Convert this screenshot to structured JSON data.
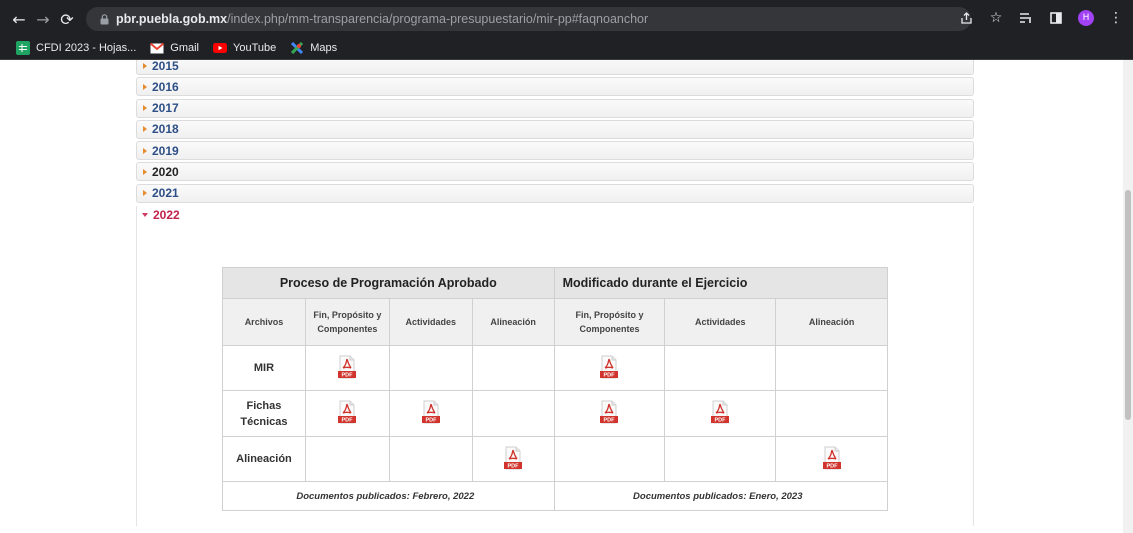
{
  "browser": {
    "url_host": "pbr.puebla.gob.mx",
    "url_path": "/index.php/mm-transparencia/programa-presupuestario/mir-pp#faqnoanchor",
    "avatar_letter": "H"
  },
  "bookmarks": [
    {
      "label": "CFDI 2023 - Hojas...",
      "icon": "sheets-icon",
      "color": "#1fa463"
    },
    {
      "label": "Gmail",
      "icon": "gmail-icon",
      "color": "#ea4335"
    },
    {
      "label": "YouTube",
      "icon": "youtube-icon",
      "color": "#ff0000"
    },
    {
      "label": "Maps",
      "icon": "maps-icon",
      "color": "#34a853"
    }
  ],
  "years": [
    "2015",
    "2016",
    "2017",
    "2018",
    "2019",
    "2020",
    "2021"
  ],
  "open_year": "2022",
  "table": {
    "group_left": "Proceso de Programación Aprobado",
    "group_right": "Modificado durante el Ejercicio",
    "col_archivos": "Archivos",
    "col_fin": "Fin, Propósito y Componentes",
    "col_actividades": "Actividades",
    "col_alineacion": "Alineación",
    "row_mir": "MIR",
    "row_fichas": "Fichas Técnicas",
    "row_alineacion": "Alineación",
    "pdf_label": "PDF",
    "footer_left": "Documentos publicados:  Febrero, 2022",
    "footer_right": "Documentos publicados:  Enero, 2023"
  }
}
